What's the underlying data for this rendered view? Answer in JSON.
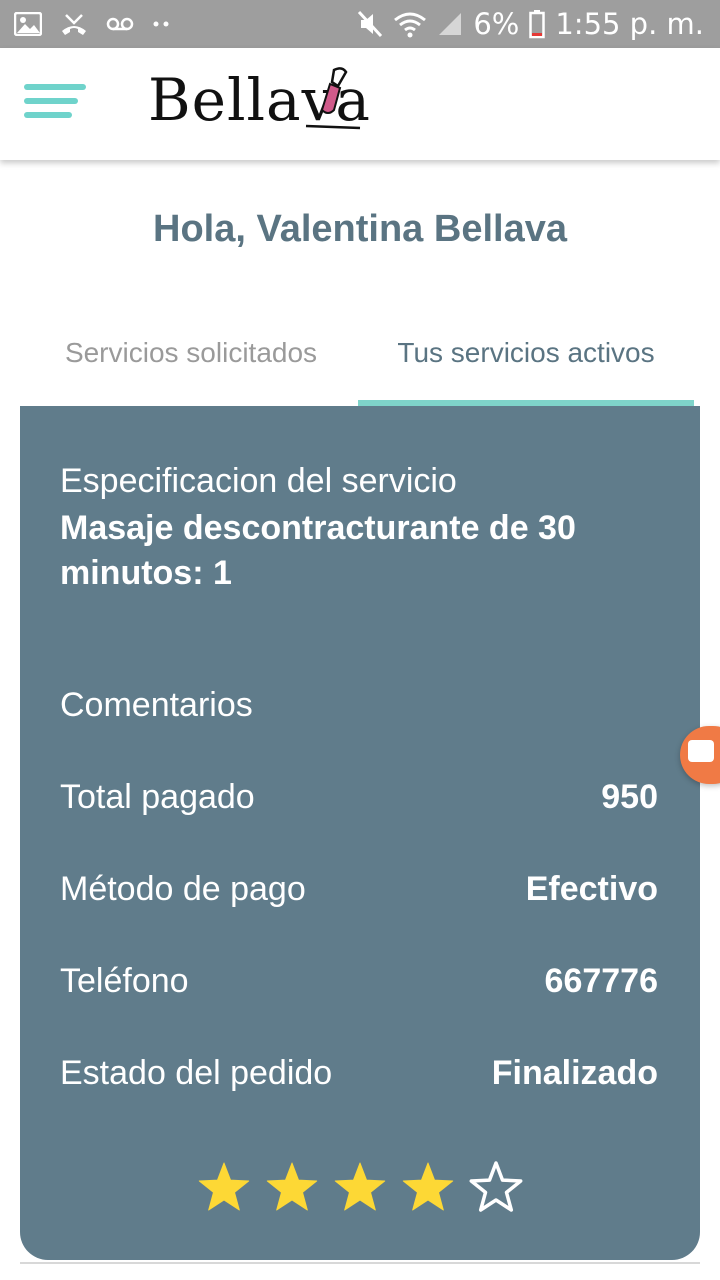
{
  "status_bar": {
    "battery_percent": "6%",
    "time": "1:55 p. m."
  },
  "header": {
    "logo_text": "Bellava"
  },
  "greeting": "Hola, Valentina Bellava",
  "tabs": [
    {
      "label": "Servicios solicitados",
      "active": false
    },
    {
      "label": "Tus servicios activos",
      "active": true
    }
  ],
  "service": {
    "spec_label": "Especificacion del servicio",
    "spec_value": "Masaje descontracturante de 30 minutos: 1",
    "comments_label": "Comentarios",
    "rows": [
      {
        "label": "Total pagado",
        "value": "950"
      },
      {
        "label": "Método de pago",
        "value": "Efectivo"
      },
      {
        "label": "Teléfono",
        "value": "667776"
      },
      {
        "label": "Estado del pedido",
        "value": "Finalizado"
      }
    ],
    "rating": 4,
    "rating_max": 5
  },
  "colors": {
    "accent": "#6fd3cb",
    "card": "#607c8b",
    "star": "#fdd835"
  }
}
